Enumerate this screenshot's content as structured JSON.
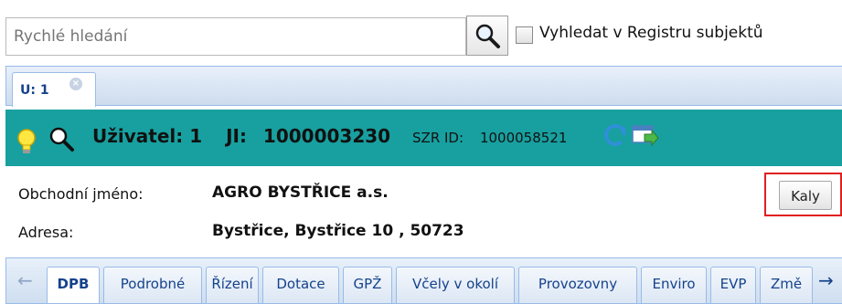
{
  "search": {
    "placeholder": "Rychlé hledání",
    "registry_label": "Vyhledat v Registru subjektů"
  },
  "doc_tabs": [
    {
      "label": "U: 1"
    }
  ],
  "header": {
    "user_label": "Uživatel: 1",
    "ji_label": "JI:",
    "ji_value": "1000003230",
    "szr_label": "SZR ID:",
    "szr_value": "1000058521"
  },
  "details": {
    "name_label": "Obchodní jméno:",
    "name_value": "AGRO BYSTŘICE a.s.",
    "address_label": "Adresa:",
    "address_value": "Bystřice, Bystřice 10 , 50723",
    "kaly_button": "Kaly"
  },
  "bottom_tabs": [
    {
      "label": "DPB",
      "active": true
    },
    {
      "label": "Podrobné"
    },
    {
      "label": "Řízení"
    },
    {
      "label": "Dotace"
    },
    {
      "label": "GPŽ"
    },
    {
      "label": "Včely v okolí"
    },
    {
      "label": "Provozovny"
    },
    {
      "label": "Enviro"
    },
    {
      "label": "EVP"
    },
    {
      "label": "Změ"
    }
  ],
  "icons": {
    "bulb": "lightbulb-icon",
    "search": "magnifier-icon",
    "refresh": "refresh-icon",
    "goto": "window-arrow-icon"
  },
  "colors": {
    "header_band": "#18a0a0",
    "tab_text": "#15428b",
    "highlight": "#e02020"
  }
}
